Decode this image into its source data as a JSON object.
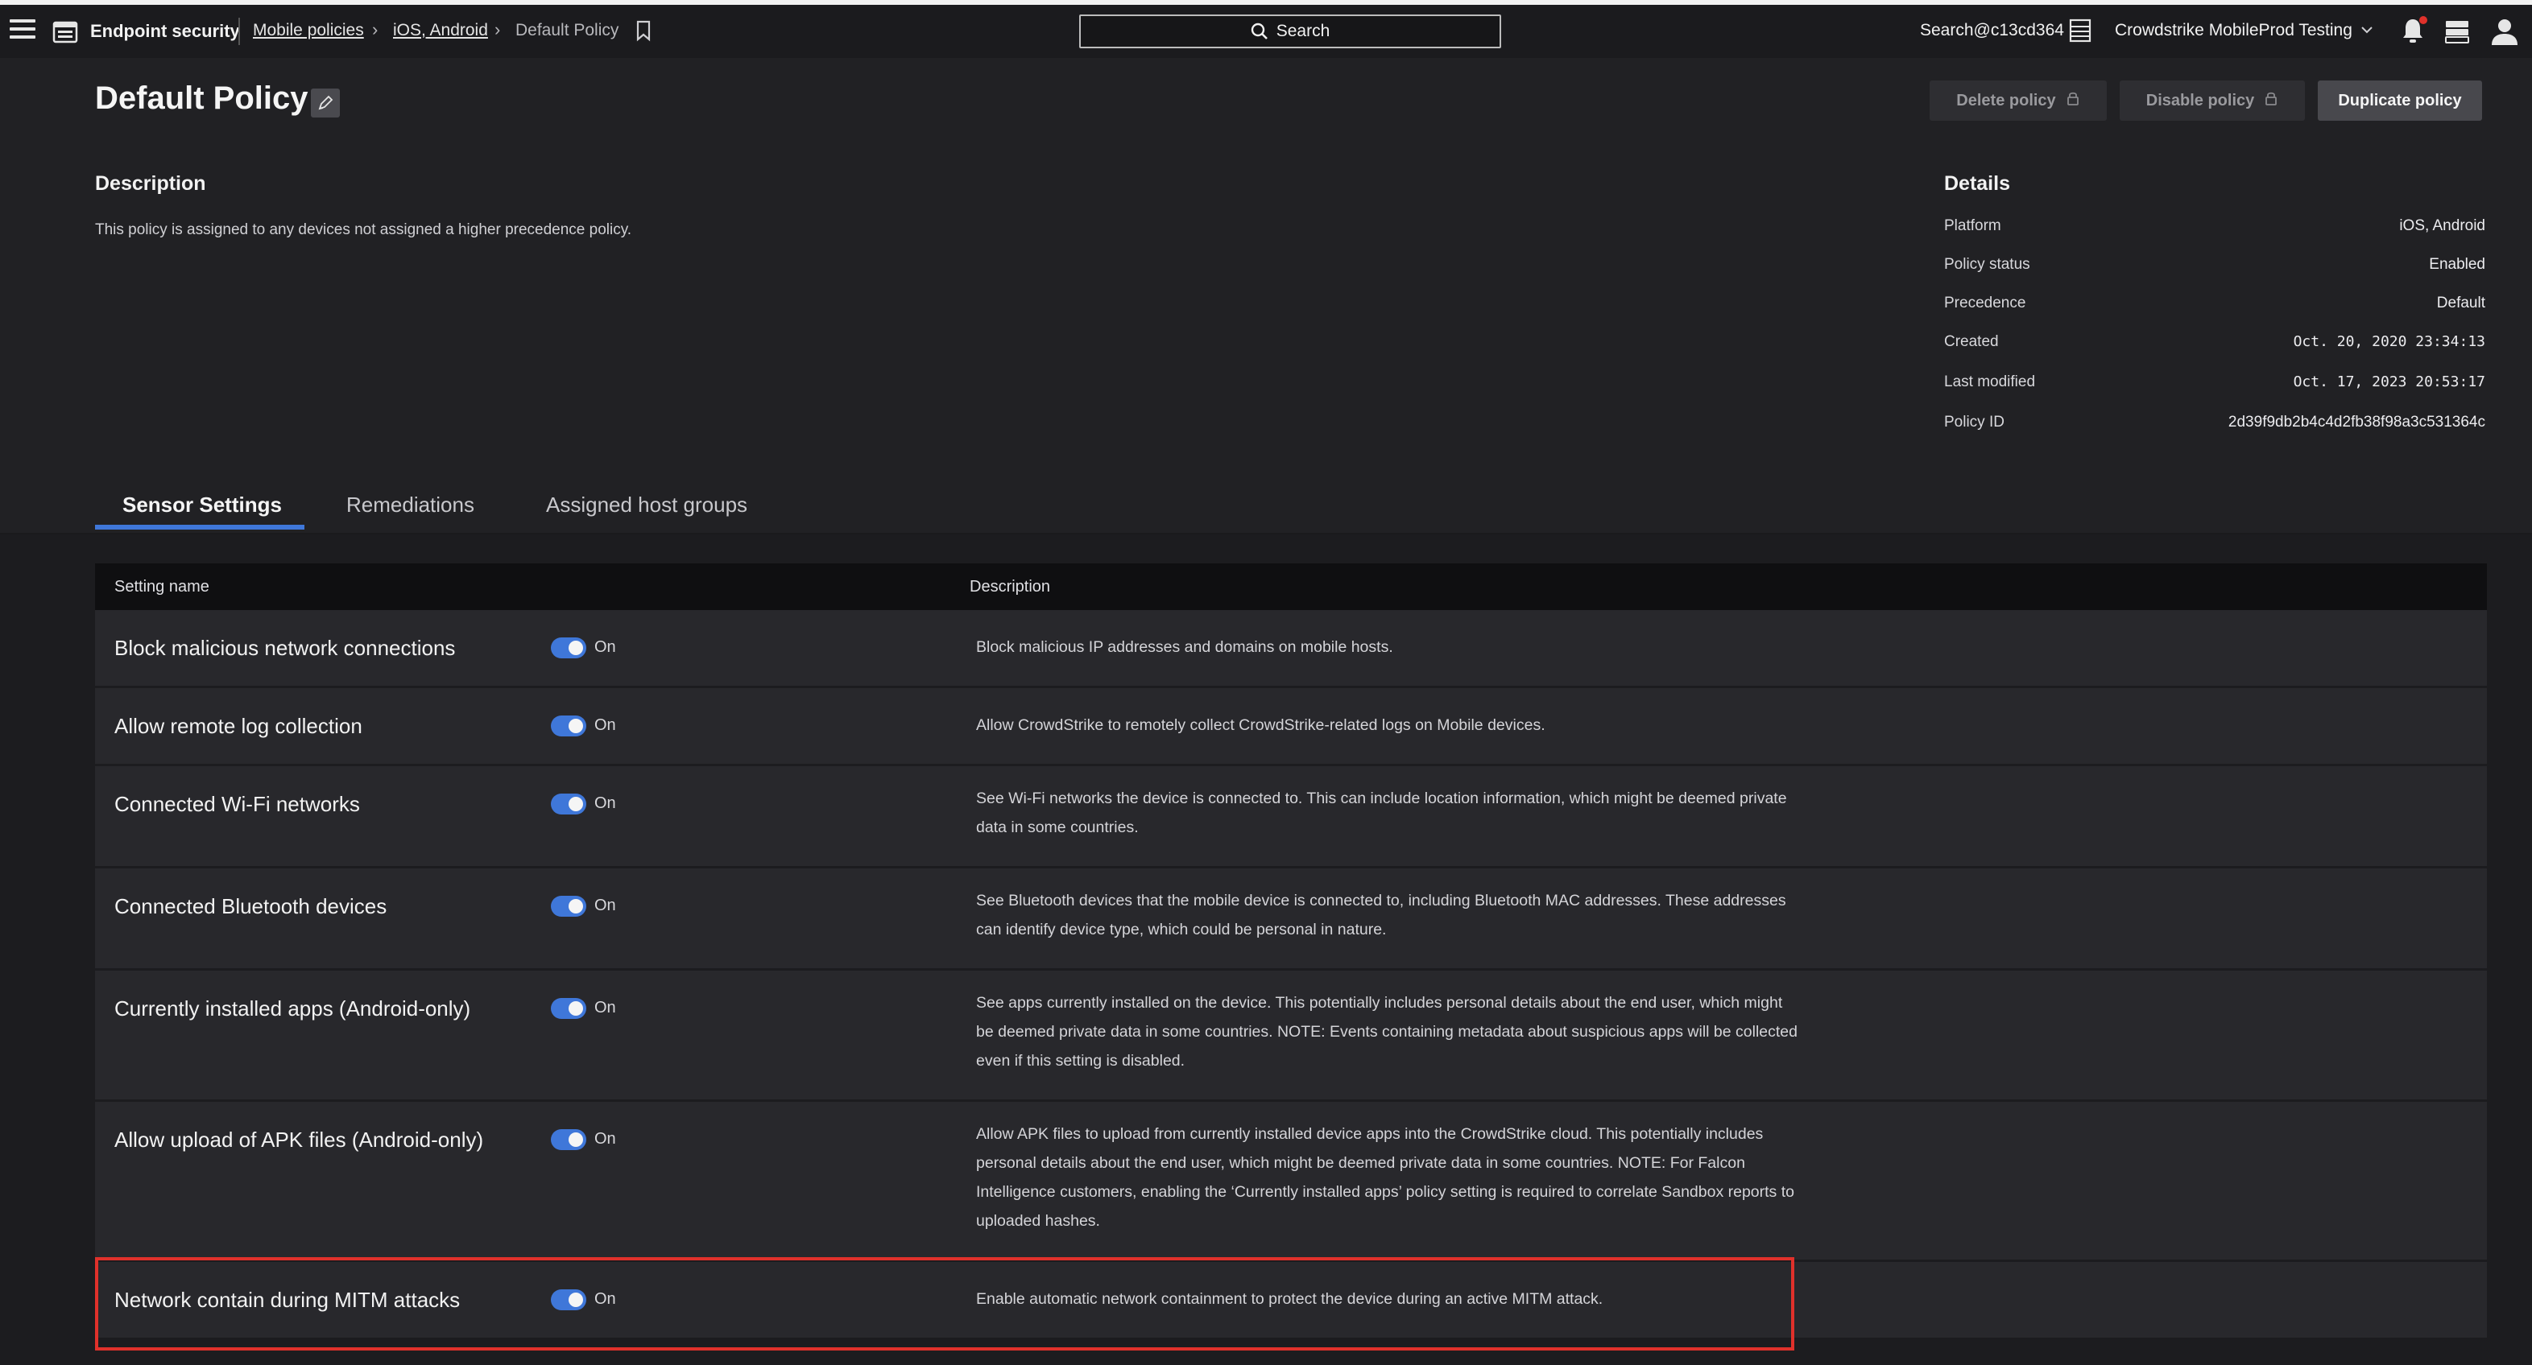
{
  "navbar": {
    "app_title": "Endpoint security",
    "breadcrumbs": [
      {
        "label": "Mobile policies"
      },
      {
        "label": "iOS, Android"
      },
      {
        "label": "Default Policy"
      }
    ],
    "search_label": "Search",
    "account": "Search@c13cd364",
    "customer": "Crowdstrike MobileProd Testing",
    "icons": [
      "hamburger-icon",
      "endpoint-app-icon",
      "bookmark-icon",
      "search-icon",
      "grid-icon",
      "chevron-down-icon",
      "bell-icon",
      "tray-icon",
      "user-icon"
    ],
    "notification_dot_color": "#e0312b"
  },
  "header": {
    "title": "Default Policy",
    "buttons": {
      "delete": "Delete policy",
      "disable": "Disable policy",
      "duplicate": "Duplicate policy"
    }
  },
  "description": {
    "heading": "Description",
    "text": "This policy is assigned to any devices not assigned a higher precedence policy."
  },
  "details": {
    "heading": "Details",
    "rows": [
      {
        "label": "Platform",
        "value": "iOS, Android"
      },
      {
        "label": "Policy status",
        "value": "Enabled"
      },
      {
        "label": "Precedence",
        "value": "Default"
      },
      {
        "label": "Created",
        "value": "Oct. 20, 2020 23:34:13"
      },
      {
        "label": "Last modified",
        "value": "Oct. 17, 2023 20:53:17"
      },
      {
        "label": "Policy ID",
        "value": "2d39f9db2b4c4d2fb38f98a3c531364c"
      }
    ]
  },
  "tabs": [
    {
      "label": "Sensor Settings",
      "active": true
    },
    {
      "label": "Remediations",
      "active": false
    },
    {
      "label": "Assigned host groups",
      "active": false
    }
  ],
  "table": {
    "headers": {
      "name": "Setting name",
      "description": "Description"
    },
    "rows": [
      {
        "name": "Block malicious network connections",
        "state": "On",
        "description": "Block malicious IP addresses and domains on mobile hosts."
      },
      {
        "name": "Allow remote log collection",
        "state": "On",
        "description": "Allow CrowdStrike to remotely collect CrowdStrike-related logs on Mobile devices."
      },
      {
        "name": "Connected Wi-Fi networks",
        "state": "On",
        "description": "See Wi-Fi networks the device is connected to. This can include location information, which might be deemed private data in some countries."
      },
      {
        "name": "Connected Bluetooth devices",
        "state": "On",
        "description": "See Bluetooth devices that the mobile device is connected to, including Bluetooth MAC addresses. These addresses can identify device type, which could be personal in nature."
      },
      {
        "name": "Currently installed apps (Android-only)",
        "state": "On",
        "description": "See apps currently installed on the device. This potentially includes personal details about the end user, which might be deemed private data in some countries. NOTE: Events containing metadata about suspicious apps will be collected even if this setting is disabled."
      },
      {
        "name": "Allow upload of APK files (Android-only)",
        "state": "On",
        "description": "Allow APK files to upload from currently installed device apps into the CrowdStrike cloud. This potentially includes personal details about the end user, which might be deemed private data in some countries. NOTE: For Falcon Intelligence customers, enabling the ‘Currently installed apps’ policy setting is required to correlate Sandbox reports to uploaded hashes."
      },
      {
        "name": "Network contain during MITM attacks",
        "state": "On",
        "description": "Enable automatic network containment to protect the device during an active MITM attack."
      }
    ]
  },
  "colors": {
    "accent": "#3f77d9",
    "highlight": "#e0312b"
  }
}
